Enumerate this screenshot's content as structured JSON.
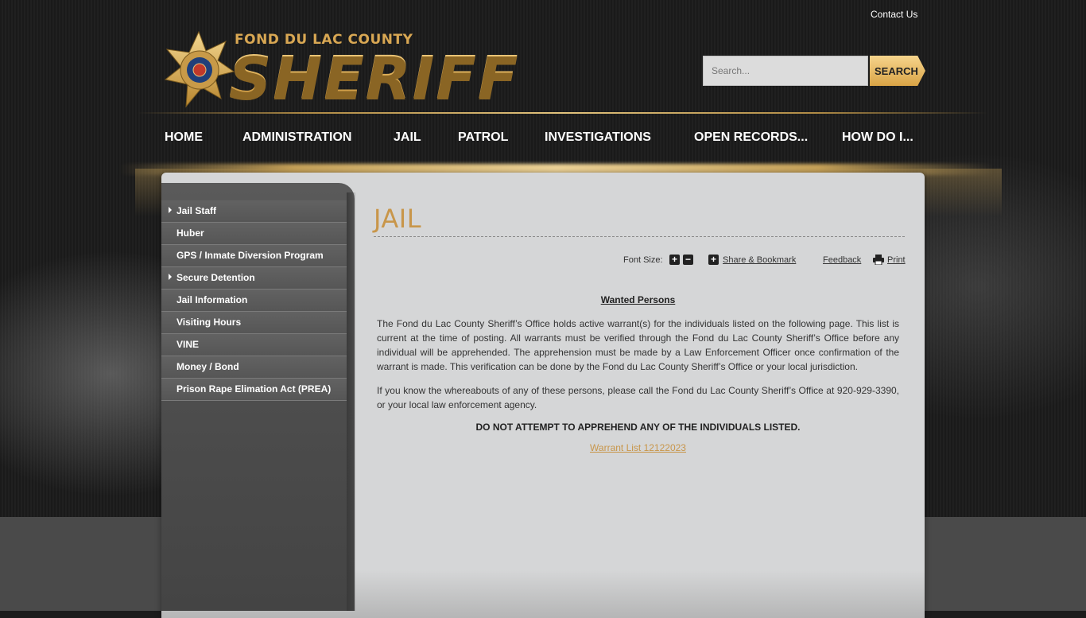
{
  "header": {
    "contact_label": "Contact Us",
    "logo_county": "FOND DU LAC COUNTY",
    "logo_title": "SHERIFF",
    "badge_text": "SHERIFF'S OFFICE FOND DU LAC COUNTY"
  },
  "search": {
    "placeholder": "Search...",
    "button_label": "SEARCH"
  },
  "nav": {
    "items": [
      "HOME",
      "ADMINISTRATION",
      "JAIL",
      "PATROL",
      "INVESTIGATIONS",
      "OPEN RECORDS...",
      "HOW DO I..."
    ]
  },
  "sidebar": {
    "items": [
      {
        "label": "Jail Staff",
        "has_submenu": true
      },
      {
        "label": "Huber",
        "has_submenu": false
      },
      {
        "label": "GPS / Inmate Diversion Program",
        "has_submenu": false
      },
      {
        "label": "Secure Detention",
        "has_submenu": true
      },
      {
        "label": "Jail Information",
        "has_submenu": false
      },
      {
        "label": "Visiting Hours",
        "has_submenu": false
      },
      {
        "label": "VINE",
        "has_submenu": false
      },
      {
        "label": "Money / Bond",
        "has_submenu": false
      },
      {
        "label": "Prison Rape Elimation Act (PREA)",
        "has_submenu": false
      }
    ]
  },
  "page": {
    "title": "JAIL"
  },
  "toolbar": {
    "font_size_label": "Font Size:",
    "increase_symbol": "+",
    "decrease_symbol": "−",
    "share_symbol": "+",
    "share_label": "Share & Bookmark",
    "feedback_label": "Feedback",
    "print_label": "Print"
  },
  "article": {
    "heading": "Wanted Persons",
    "paragraph1": "The Fond du Lac County Sheriff’s Office holds active warrant(s) for the individuals listed on the following page. This list is current at the time of posting. All warrants must be verified through the Fond du Lac County Sheriff’s Office before any individual will be apprehended. The apprehension must be made by a Law Enforcement Officer once confirmation of the warrant is made. This verification can be done by the Fond du Lac County Sheriff’s Office or your local jurisdiction.",
    "paragraph2": "If you know the whereabouts of any of these persons, please call the Fond du Lac County Sheriff’s Office at 920-929-3390, or your local law enforcement agency.",
    "warning": "DO NOT ATTEMPT TO APPREHEND ANY OF THE INDIVIDUALS LISTED.",
    "link_label": "Warrant List 12122023"
  },
  "colors": {
    "accent_gold": "#c8964a",
    "content_bg": "#d5d6d7",
    "sidebar_bg": "#565656"
  }
}
